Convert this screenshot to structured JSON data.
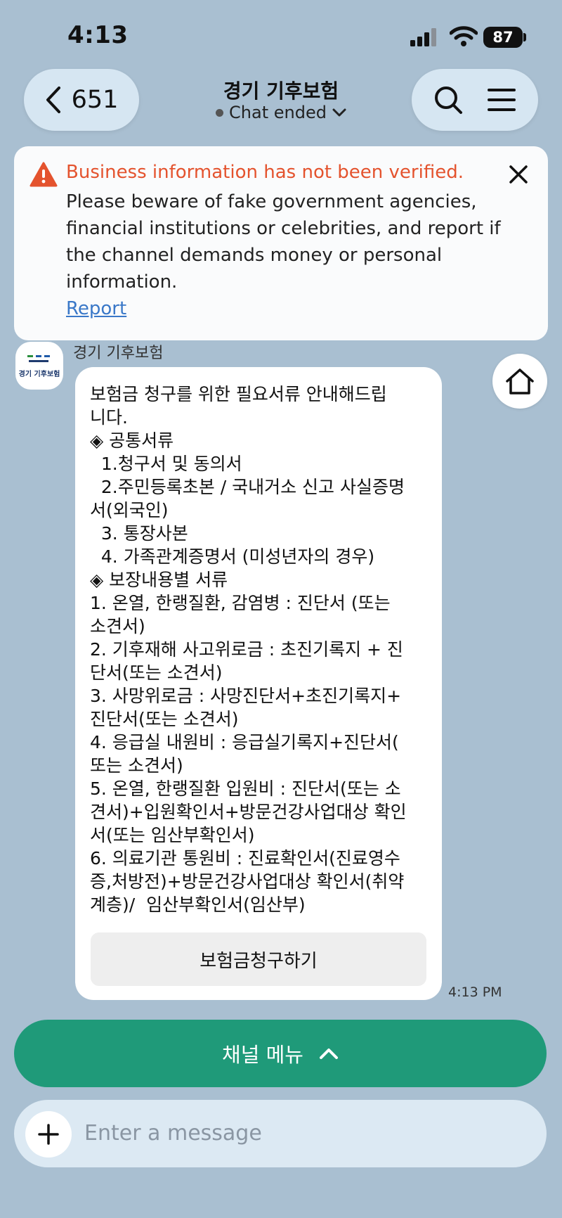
{
  "status_bar": {
    "time": "4:13",
    "battery": "87"
  },
  "header": {
    "back_count": "651",
    "title": "경기 기후보험",
    "status": "Chat ended"
  },
  "warning": {
    "title": "Business information has not been verified.",
    "body": "Please beware of fake government agencies, financial institutions or celebrities, and report if the channel demands money or personal information.",
    "link": "Report"
  },
  "chat": {
    "sender": "경기 기후보험",
    "avatar_text": "경기 기후보험",
    "message": "보험금 청구를 위한 필요서류 안내해드립\n니다.\n◈ 공통서류\n  1.청구서 및 동의서\n  2.주민등록초본 / 국내거소 신고 사실증명\n서(외국인)\n  3. 통장사본\n  4. 가족관계증명서 (미성년자의 경우)\n◈ 보장내용별 서류\n1. 온열, 한랭질환, 감염병 : 진단서 (또는\n소견서)\n2. 기후재해 사고위로금 : 초진기록지 + 진\n단서(또는 소견서)\n3. 사망위로금 : 사망진단서+초진기록지+\n진단서(또는 소견서)\n4. 응급실 내원비 : 응급실기록지+진단서(\n또는 소견서)\n5. 온열, 한랭질환 입원비 : 진단서(또는 소\n견서)+입원확인서+방문건강사업대상 확인\n서(또는 임산부확인서)\n6. 의료기관 통원비 : 진료확인서(진료영수\n증,처방전)+방문건강사업대상 확인서(취약\n계층)/  임산부확인서(임산부)",
    "button_label": "보험금청구하기",
    "time": "4:13 PM"
  },
  "bottom": {
    "menu_label": "채널 메뉴",
    "input_placeholder": "Enter a message"
  },
  "colors": {
    "background": "#a9bfd1",
    "menu_green": "#1f9a79",
    "warning_orange": "#e4532e",
    "link_blue": "#3a78c8"
  }
}
